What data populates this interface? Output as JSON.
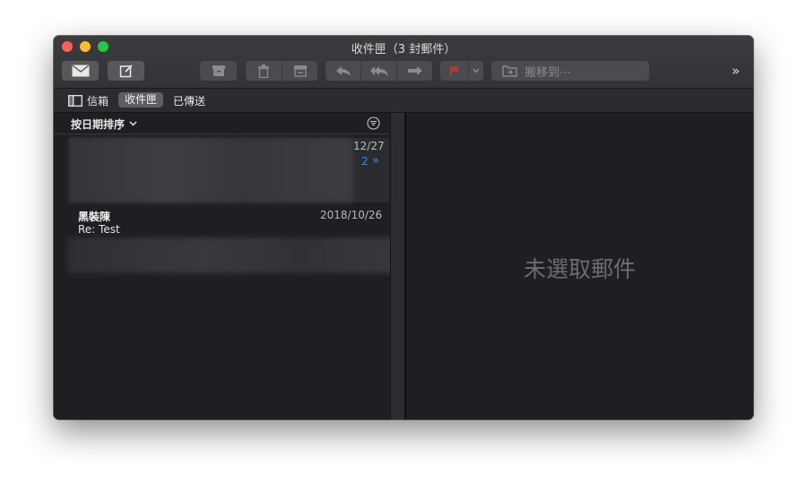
{
  "window": {
    "title": "收件匣（3 封郵件）"
  },
  "toolbar": {
    "get_mail_icon": "envelope-icon",
    "compose_icon": "compose-icon",
    "archive_icon": "archive-icon",
    "delete_icon": "trash-icon",
    "junk_icon": "junk-icon",
    "reply_icon": "reply-icon",
    "reply_all_icon": "reply-all-icon",
    "forward_icon": "forward-icon",
    "flag_icon": "flag-icon",
    "flag_color": "#e0443e",
    "move_to_label": "搬移到⋯",
    "overflow_label": "»"
  },
  "favorites": {
    "mailboxes_label": "信箱",
    "inbox_label": "收件匣",
    "sent_label": "已傳送"
  },
  "message_list": {
    "sort_label": "按日期排序",
    "sort_chevron": "⌄",
    "messages": [
      {
        "date": "12/27",
        "thread_count": "2",
        "thread_icon": "»"
      },
      {
        "sender": "黑裝陳",
        "date": "2018/10/26",
        "subject": "Re: Test"
      }
    ]
  },
  "preview": {
    "empty_label": "未選取郵件"
  },
  "colors": {
    "accent": "#2f8ef5"
  }
}
